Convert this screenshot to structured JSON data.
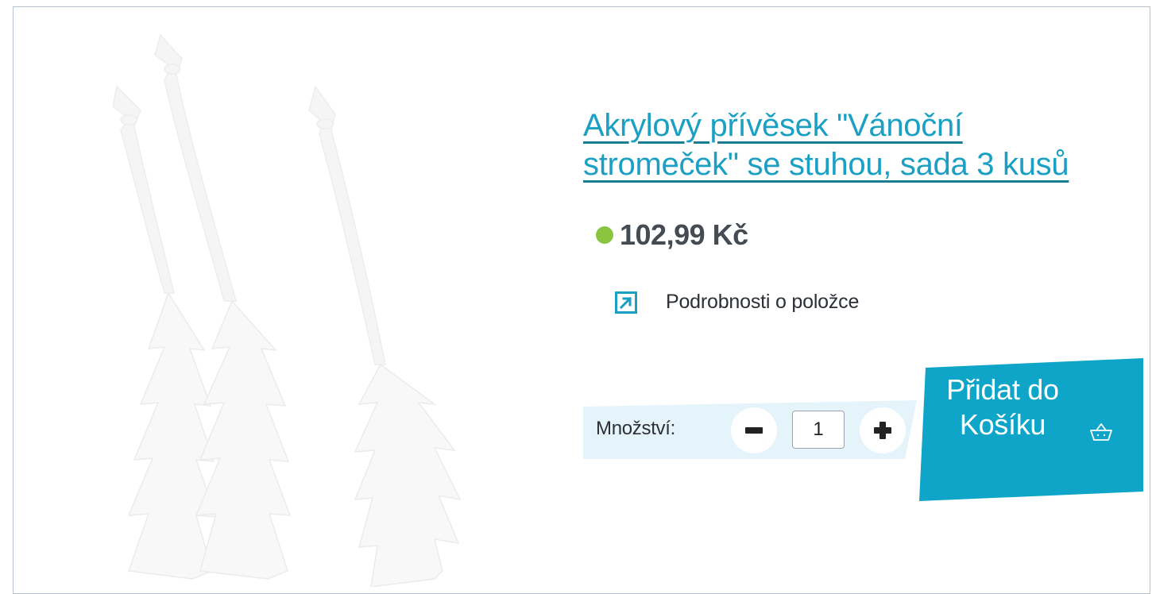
{
  "product": {
    "title": "Akrylový přívěsek \"Vánoční stromeček\" se stuhou, sada 3 kusů",
    "price": "102,99 Kč",
    "stock_color": "#8bc53f",
    "details_label": "Podrobnosti o položce",
    "details_icon": "external-link-arrow-icon",
    "image_icon": "product-photo-white-tree-ornaments"
  },
  "quantity": {
    "label": "Množství:",
    "value": "1",
    "decrement_icon": "minus-icon",
    "increment_icon": "plus-icon"
  },
  "cart": {
    "button_label": "Přidat do Košíku",
    "icon": "basket-icon",
    "color": "#0fa5c8"
  },
  "colors": {
    "accent": "#1ba0c4",
    "band": "#e4f4fa",
    "text": "#2b3036"
  }
}
